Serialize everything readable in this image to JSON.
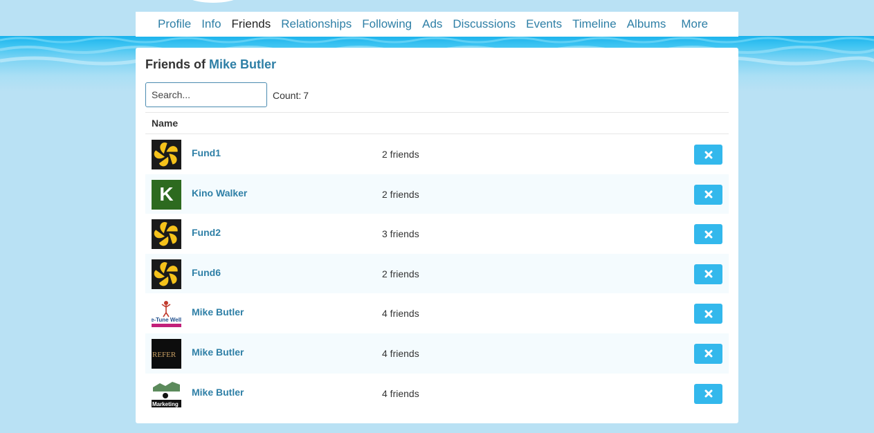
{
  "nav": {
    "items": [
      "Profile",
      "Info",
      "Friends",
      "Relationships",
      "Following",
      "Ads",
      "Discussions",
      "Events",
      "Timeline",
      "Albums"
    ],
    "active": "Friends",
    "more_label": "More"
  },
  "page": {
    "title_prefix": "Friends of",
    "owner_name": "Mike Butler"
  },
  "search": {
    "placeholder": "Search..."
  },
  "count": {
    "label": "Count:",
    "value": "7"
  },
  "table": {
    "header_name": "Name",
    "rows": [
      {
        "name": "Fund1",
        "friends": "2 friends",
        "avatar": "gold-star-logo"
      },
      {
        "name": "Kino Walker",
        "friends": "2 friends",
        "avatar": "letter-k"
      },
      {
        "name": "Fund2",
        "friends": "3 friends",
        "avatar": "gold-star-logo"
      },
      {
        "name": "Fund6",
        "friends": "2 friends",
        "avatar": "gold-star-logo"
      },
      {
        "name": "Mike Butler",
        "friends": "4 friends",
        "avatar": "fine-tune-wellness-logo"
      },
      {
        "name": "Mike Butler",
        "friends": "4 friends",
        "avatar": "refer-logo"
      },
      {
        "name": "Mike Butler",
        "friends": "4 friends",
        "avatar": "marketing-logo"
      }
    ]
  },
  "avatar_text": {
    "letter": "K",
    "wellness": "e-Tune Well",
    "refer": "REFER",
    "marketing": "Marketing"
  },
  "colors": {
    "accent": "#2e7fa6",
    "button": "#33b8ec",
    "background": "#b9e1f4",
    "avatar_green": "#2d6a1f",
    "gold": "#f5c21b"
  }
}
